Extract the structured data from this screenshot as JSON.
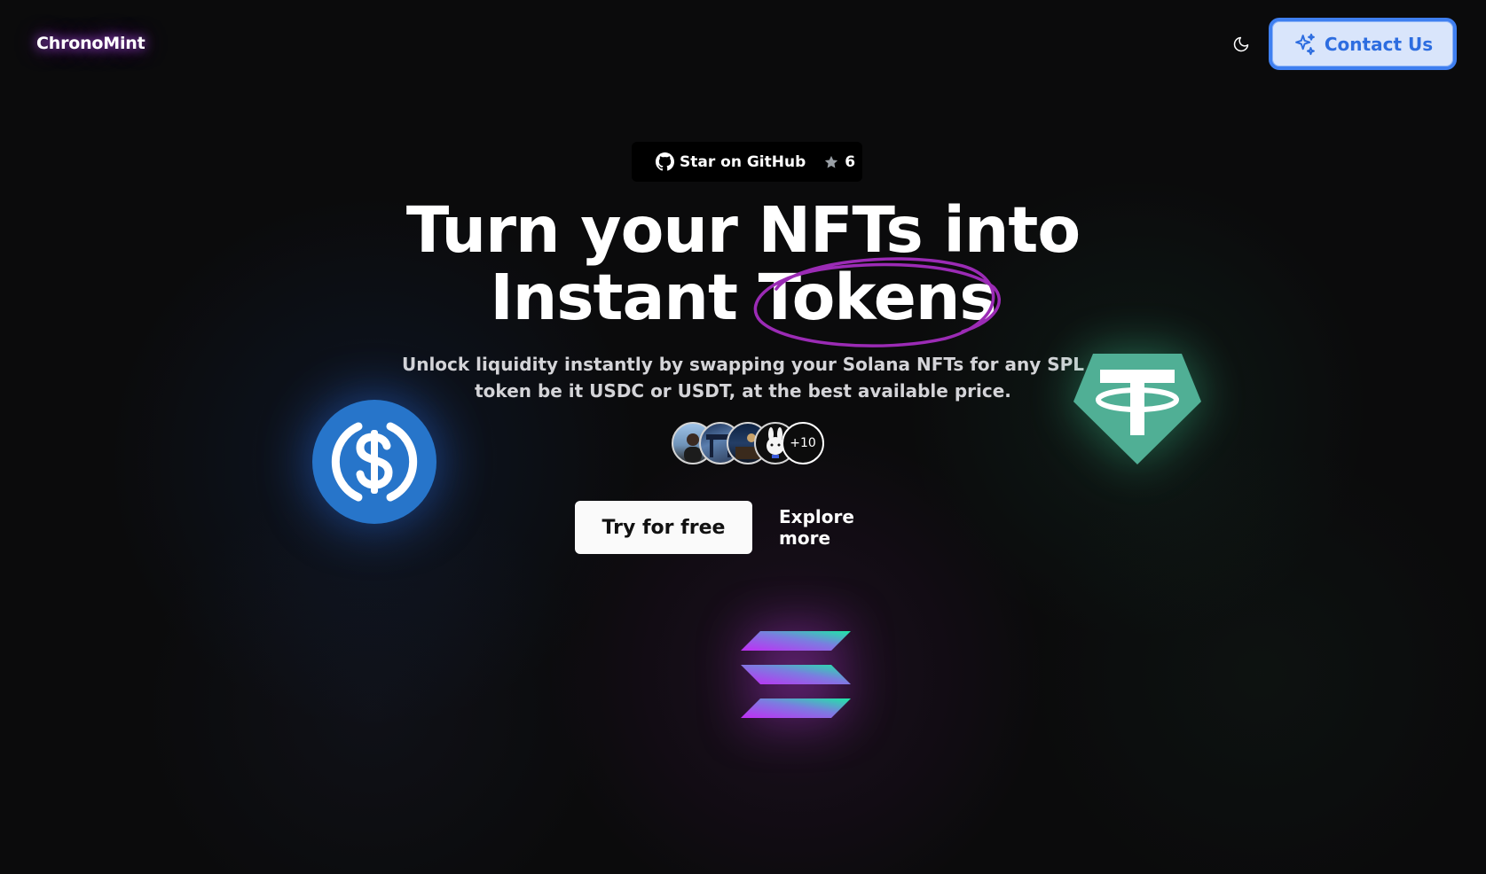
{
  "header": {
    "logo_text": "ChronoMint",
    "theme_toggle_icon": "moon-icon",
    "contact_label": "Contact Us",
    "contact_icon": "sparkles-icon"
  },
  "github": {
    "label": "Star on GitHub",
    "star_count": "6",
    "icon": "github-icon"
  },
  "hero": {
    "title_line1": "Turn your NFTs into",
    "title_line2_prefix": "Instant",
    "title_highlight": "Tokens",
    "subtitle_line1": "Unlock liquidity instantly by swapping your Solana NFTs for any SPL",
    "subtitle_line2": "token be it USDC or USDT, at the best available price."
  },
  "avatars": {
    "extra_count": "+10"
  },
  "cta": {
    "primary_label": "Try for free",
    "secondary_label": "Explore more"
  },
  "colors": {
    "background": "#0b0b0c",
    "accent_purple": "#9b2bb5",
    "contact_bg": "#d9e5fb",
    "contact_border": "#3f7ff0",
    "usdc_blue": "#2775ca",
    "usdt_green": "#50af95"
  },
  "coins": [
    "usdc-coin-icon",
    "usdt-coin-icon",
    "solana-icon"
  ]
}
